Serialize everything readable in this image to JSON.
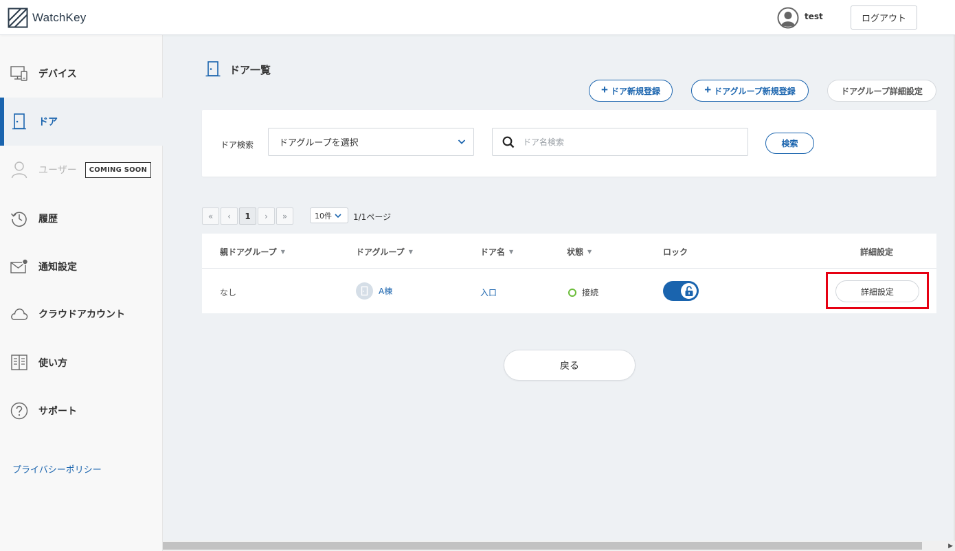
{
  "header": {
    "logo_text": "WatchKey",
    "user_name": "test",
    "logout_label": "ログアウト"
  },
  "sidebar": {
    "items": [
      {
        "label": "デバイス",
        "icon": "device-icon"
      },
      {
        "label": "ドア",
        "icon": "door-icon",
        "active": true
      },
      {
        "label": "ユーザー",
        "icon": "user-icon",
        "disabled": true,
        "badge": "COMING SOON"
      },
      {
        "label": "履歴",
        "icon": "history-icon"
      },
      {
        "label": "通知設定",
        "icon": "mail-icon"
      },
      {
        "label": "クラウドアカウント",
        "icon": "cloud-icon"
      },
      {
        "label": "使い方",
        "icon": "book-icon"
      },
      {
        "label": "サポート",
        "icon": "help-icon"
      }
    ],
    "privacy_label": "プライバシーポリシー"
  },
  "main": {
    "title": "ドア一覧",
    "actions": {
      "new_door": "ドア新規登録",
      "new_group": "ドアグループ新規登録",
      "group_settings": "ドアグループ詳細設定"
    },
    "search": {
      "label": "ドア検索",
      "group_select_value": "ドアグループを選択",
      "name_placeholder": "ドア名検索",
      "button_label": "検索"
    },
    "pagination": {
      "first": "«",
      "prev": "‹",
      "current": "1",
      "next": "›",
      "last": "»",
      "per_page": "10件",
      "page_info": "1/1ページ"
    },
    "table": {
      "columns": [
        "親ドアグループ",
        "ドアグループ",
        "ドア名",
        "状態",
        "ロック",
        "詳細設定"
      ],
      "rows": [
        {
          "parent_group": "なし",
          "group": "A棟",
          "door_name": "入口",
          "status": "接続",
          "lock": "unlocked",
          "detail_label": "詳細設定"
        }
      ]
    },
    "back_label": "戻る"
  },
  "colors": {
    "accent": "#1a64ae",
    "status_connected": "#6cbd3b",
    "highlight": "#e60012",
    "background": "#eef1f4"
  }
}
